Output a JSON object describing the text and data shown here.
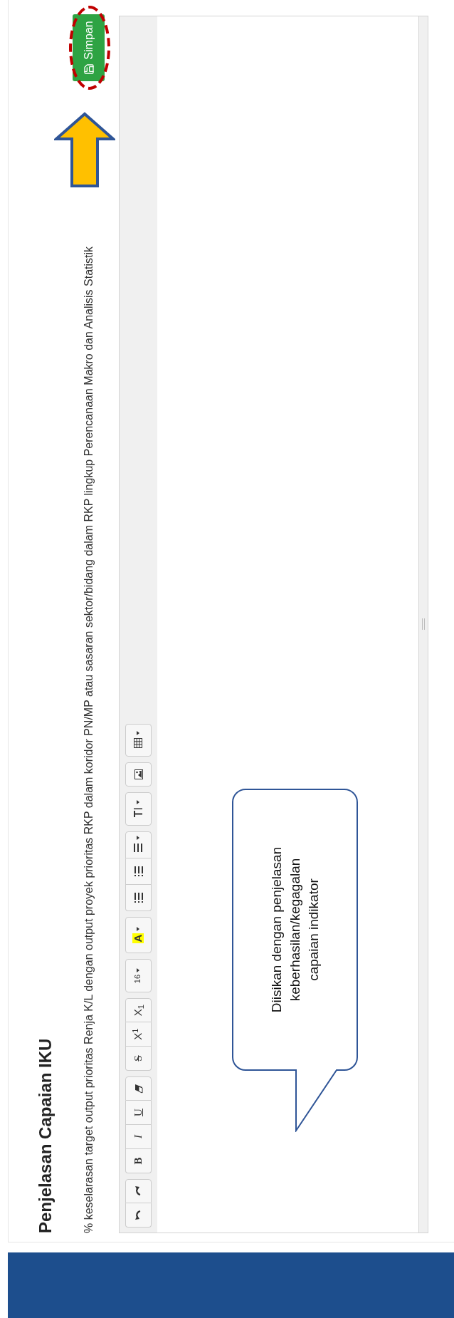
{
  "page": {
    "title": "Penjelasan Capaian IKU",
    "description": "% keselarasan target output prioritas Renja K/L dengan output proyek prioritas RKP dalam koridor PN/MP atau sasaran sektor/bidang dalam RKP lingkup Perencanaan Makro dan Analisis Statistik"
  },
  "save_button": {
    "label": "Simpan"
  },
  "toolbar": {
    "groups": [
      [
        {
          "kind": "undo",
          "dropdown": false
        },
        {
          "kind": "redo",
          "dropdown": false
        }
      ],
      [
        {
          "kind": "bold",
          "label": "B",
          "dropdown": false
        },
        {
          "kind": "italic",
          "label": "I",
          "dropdown": false
        },
        {
          "kind": "underline",
          "label": "U",
          "dropdown": false
        },
        {
          "kind": "eraser",
          "dropdown": false
        }
      ],
      [
        {
          "kind": "strikethrough",
          "label": "S",
          "dropdown": false
        },
        {
          "kind": "superscript",
          "label": "X$^{1}$",
          "dropdown": false
        },
        {
          "kind": "subscript",
          "label": "X$_{1}$",
          "dropdown": false
        }
      ],
      [
        {
          "kind": "font-size",
          "label": "16",
          "dropdown": true
        }
      ],
      [
        {
          "kind": "color",
          "label": "A",
          "dropdown": true
        }
      ],
      [
        {
          "kind": "bullet-list",
          "dropdown": false
        },
        {
          "kind": "numbered-list",
          "dropdown": false
        },
        {
          "kind": "align",
          "dropdown": true
        }
      ],
      [
        {
          "kind": "line-height",
          "dropdown": true
        }
      ],
      [
        {
          "kind": "image",
          "dropdown": false
        }
      ],
      [
        {
          "kind": "table",
          "dropdown": true
        }
      ]
    ]
  },
  "callout": {
    "lines": [
      "Diisikan dengan penjelasan",
      "keberhasilan/kegagalan",
      "capaian indikator"
    ]
  }
}
